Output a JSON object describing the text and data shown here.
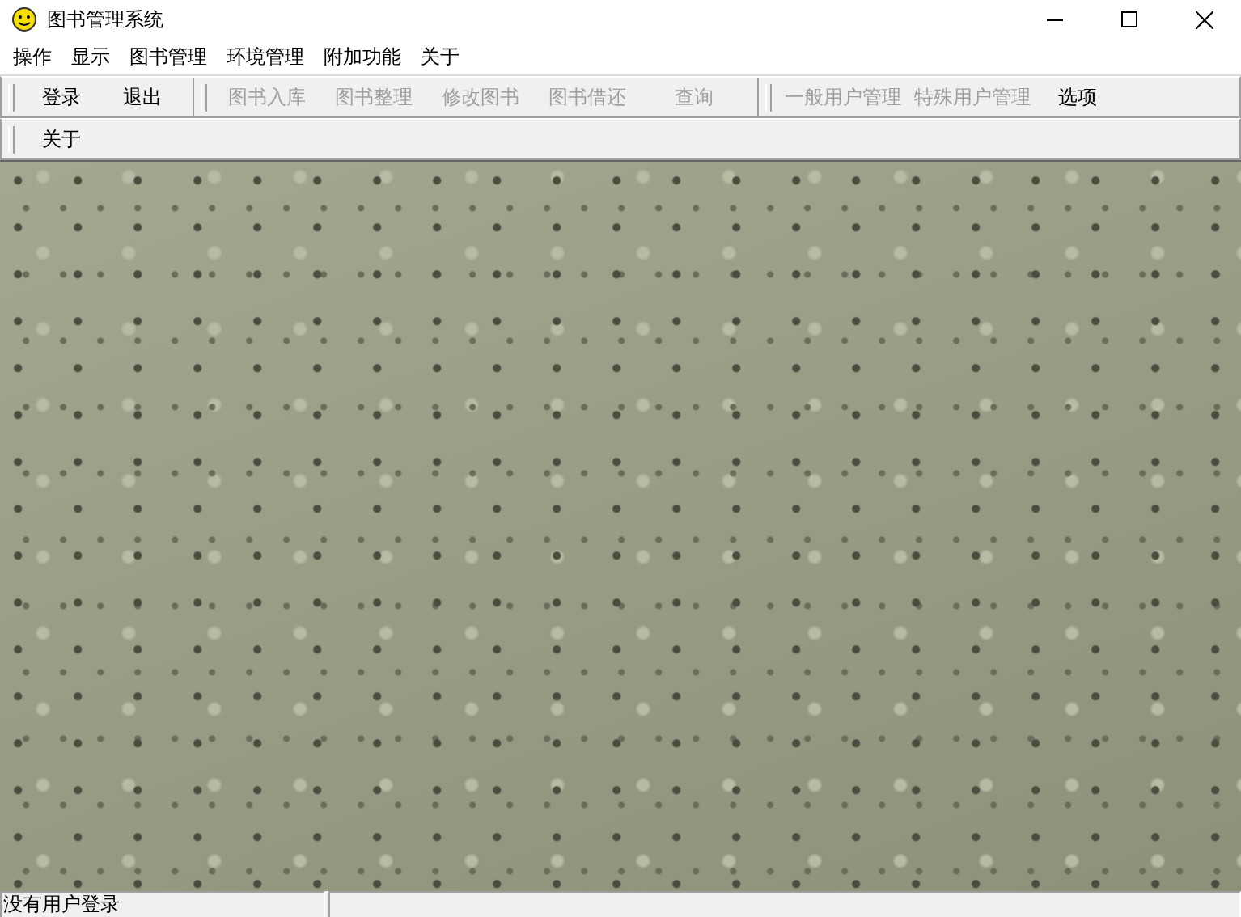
{
  "window": {
    "title": "图书管理系统"
  },
  "menu": [
    "操作",
    "显示",
    "图书管理",
    "环境管理",
    "附加功能",
    "关于"
  ],
  "toolbar_bands": [
    {
      "groups": [
        {
          "buttons": [
            {
              "label": "登录",
              "disabled": false
            },
            {
              "label": "退出",
              "disabled": false
            }
          ]
        },
        {
          "buttons": [
            {
              "label": "图书入库",
              "disabled": true
            },
            {
              "label": "图书整理",
              "disabled": true
            },
            {
              "label": "修改图书",
              "disabled": true
            },
            {
              "label": "图书借还",
              "disabled": true
            },
            {
              "label": "查询",
              "disabled": true
            }
          ]
        },
        {
          "buttons": [
            {
              "label": "一般用户管理",
              "disabled": true
            },
            {
              "label": "特殊用户管理",
              "disabled": true
            },
            {
              "label": "选项",
              "disabled": false
            }
          ]
        }
      ]
    },
    {
      "groups": [
        {
          "buttons": [
            {
              "label": "关于",
              "disabled": false
            }
          ]
        }
      ]
    }
  ],
  "status_bar": {
    "message": "没有用户登录"
  }
}
